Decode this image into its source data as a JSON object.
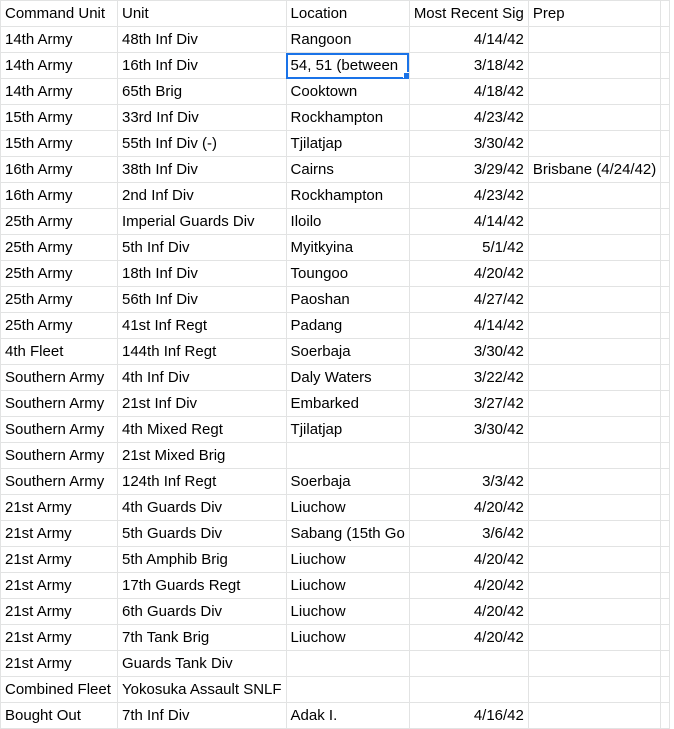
{
  "header": {
    "command_unit": "Command Unit",
    "unit": "Unit",
    "location": "Location",
    "most_recent_sig": "Most Recent Sig",
    "prep": "Prep"
  },
  "rows": [
    {
      "command": "14th Army",
      "unit": "48th Inf Div",
      "location": "Rangoon",
      "date": "4/14/42",
      "prep": ""
    },
    {
      "command": "14th Army",
      "unit": "16th Inf Div",
      "location": "54, 51 (between",
      "date": "3/18/42",
      "prep": ""
    },
    {
      "command": "14th Army",
      "unit": "65th Brig",
      "location": "Cooktown",
      "date": "4/18/42",
      "prep": ""
    },
    {
      "command": "15th Army",
      "unit": "33rd Inf Div",
      "location": "Rockhampton",
      "date": "4/23/42",
      "prep": ""
    },
    {
      "command": "15th Army",
      "unit": "55th Inf Div (-)",
      "location": "Tjilatjap",
      "date": "3/30/42",
      "prep": ""
    },
    {
      "command": "16th Army",
      "unit": "38th Inf Div",
      "location": "Cairns",
      "date": "3/29/42",
      "prep": "Brisbane (4/24/42)"
    },
    {
      "command": "16th Army",
      "unit": "2nd Inf Div",
      "location": "Rockhampton",
      "date": "4/23/42",
      "prep": ""
    },
    {
      "command": "25th Army",
      "unit": "Imperial Guards Div",
      "location": "Iloilo",
      "date": "4/14/42",
      "prep": ""
    },
    {
      "command": "25th Army",
      "unit": "5th Inf Div",
      "location": "Myitkyina",
      "date": "5/1/42",
      "prep": ""
    },
    {
      "command": "25th Army",
      "unit": "18th Inf Div",
      "location": "Toungoo",
      "date": "4/20/42",
      "prep": ""
    },
    {
      "command": "25th Army",
      "unit": "56th Inf Div",
      "location": "Paoshan",
      "date": "4/27/42",
      "prep": ""
    },
    {
      "command": "25th Army",
      "unit": "41st Inf Regt",
      "location": "Padang",
      "date": "4/14/42",
      "prep": ""
    },
    {
      "command": "4th Fleet",
      "unit": "144th Inf Regt",
      "location": "Soerbaja",
      "date": "3/30/42",
      "prep": ""
    },
    {
      "command": "Southern Army",
      "unit": "4th Inf Div",
      "location": "Daly Waters",
      "date": "3/22/42",
      "prep": ""
    },
    {
      "command": "Southern Army",
      "unit": "21st Inf Div",
      "location": "Embarked",
      "date": "3/27/42",
      "prep": ""
    },
    {
      "command": "Southern Army",
      "unit": "4th Mixed Regt",
      "location": "Tjilatjap",
      "date": "3/30/42",
      "prep": ""
    },
    {
      "command": "Southern Army",
      "unit": "21st Mixed Brig",
      "location": "",
      "date": "",
      "prep": ""
    },
    {
      "command": "Southern Army",
      "unit": "124th Inf Regt",
      "location": "Soerbaja",
      "date": "3/3/42",
      "prep": ""
    },
    {
      "command": "21st Army",
      "unit": "4th Guards Div",
      "location": "Liuchow",
      "date": "4/20/42",
      "prep": ""
    },
    {
      "command": "21st Army",
      "unit": "5th Guards Div",
      "location": "Sabang (15th Go",
      "date": "3/6/42",
      "prep": ""
    },
    {
      "command": "21st Army",
      "unit": "5th Amphib Brig",
      "location": "Liuchow",
      "date": "4/20/42",
      "prep": ""
    },
    {
      "command": "21st Army",
      "unit": "17th Guards Regt",
      "location": "Liuchow",
      "date": "4/20/42",
      "prep": ""
    },
    {
      "command": "21st Army",
      "unit": "6th Guards Div",
      "location": "Liuchow",
      "date": "4/20/42",
      "prep": ""
    },
    {
      "command": "21st Army",
      "unit": "7th Tank Brig",
      "location": "Liuchow",
      "date": "4/20/42",
      "prep": ""
    },
    {
      "command": "21st Army",
      "unit": "Guards Tank Div",
      "location": "",
      "date": "",
      "prep": ""
    },
    {
      "command": "Combined Fleet",
      "unit": "Yokosuka Assault SNLF",
      "location": "",
      "date": "",
      "prep": ""
    },
    {
      "command": "Bought Out",
      "unit": "7th Inf Div",
      "location": "Adak I.",
      "date": "4/16/42",
      "prep": ""
    }
  ],
  "selection": {
    "row": 1,
    "column": "location",
    "color": "#1a73e8"
  },
  "gridline_color": "#e2e3e3"
}
